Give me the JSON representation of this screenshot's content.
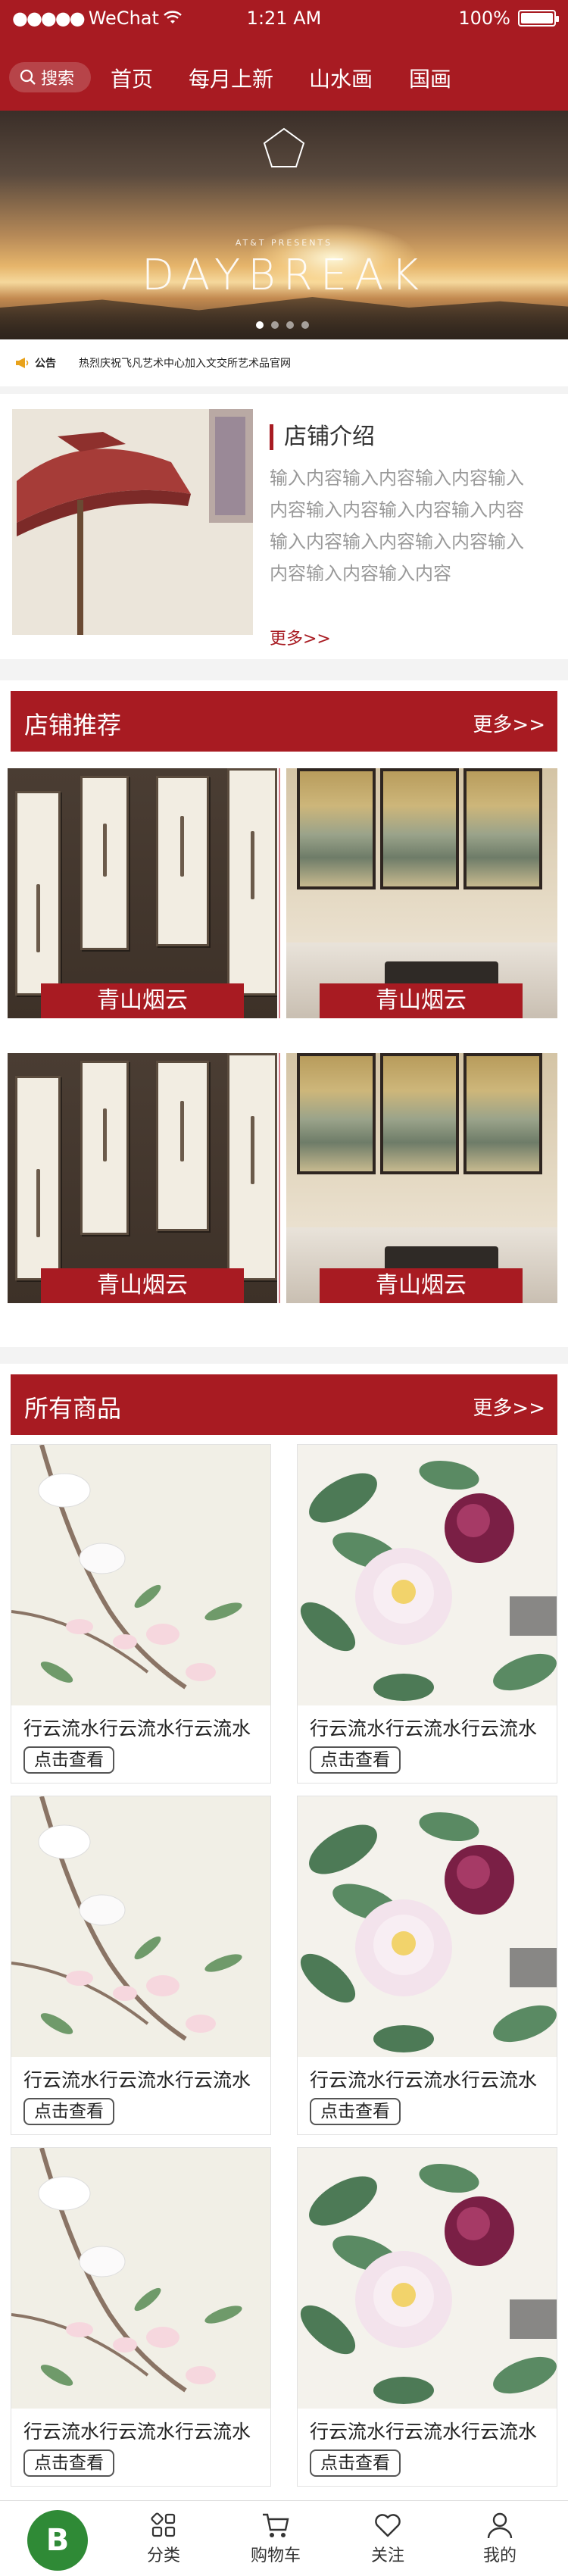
{
  "status": {
    "carrier": "WeChat",
    "time": "1:21 AM",
    "battery": "100%"
  },
  "header": {
    "search_label": "搜索",
    "tabs": [
      "首页",
      "每月上新",
      "山水画",
      "国画"
    ]
  },
  "banner": {
    "pre_title": "AT&T PRESENTS",
    "title": "DAYBREAK",
    "slide_count": 4,
    "active_slide": 1
  },
  "notice": {
    "label": "公告",
    "text": "热烈庆祝飞凡艺术中心加入文交所艺术品官网"
  },
  "intro": {
    "title": "店铺介绍",
    "text": "输入内容输入内容输入内容输入内容输入内容输入内容输入内容输入内容输入内容输入内容输入内容输入内容输入内容",
    "more": "更多>>"
  },
  "recommend": {
    "title": "店铺推荐",
    "more": "更多>>",
    "items": [
      {
        "label": "青山烟云",
        "style": "gallery"
      },
      {
        "label": "青山烟云",
        "style": "room"
      },
      {
        "label": "青山烟云",
        "style": "gallery"
      },
      {
        "label": "青山烟云",
        "style": "room"
      }
    ]
  },
  "products": {
    "title": "所有商品",
    "more": "更多>>",
    "items": [
      {
        "title": "行云流水行云流水行云流水",
        "button": "点击查看"
      },
      {
        "title": "行云流水行云流水行云流水",
        "button": "点击查看"
      },
      {
        "title": "行云流水行云流水行云流水",
        "button": "点击查看"
      },
      {
        "title": "行云流水行云流水行云流水",
        "button": "点击查看"
      },
      {
        "title": "行云流水行云流水行云流水",
        "button": "点击查看"
      },
      {
        "title": "行云流水行云流水行云流水",
        "button": "点击查看"
      }
    ]
  },
  "tabbar": {
    "home_logo": "B",
    "items": [
      "分类",
      "购物车",
      "关注",
      "我的"
    ]
  },
  "colors": {
    "brand": "#a81b22",
    "accent_link": "#a81b22",
    "logo_green": "#2f8a36"
  }
}
